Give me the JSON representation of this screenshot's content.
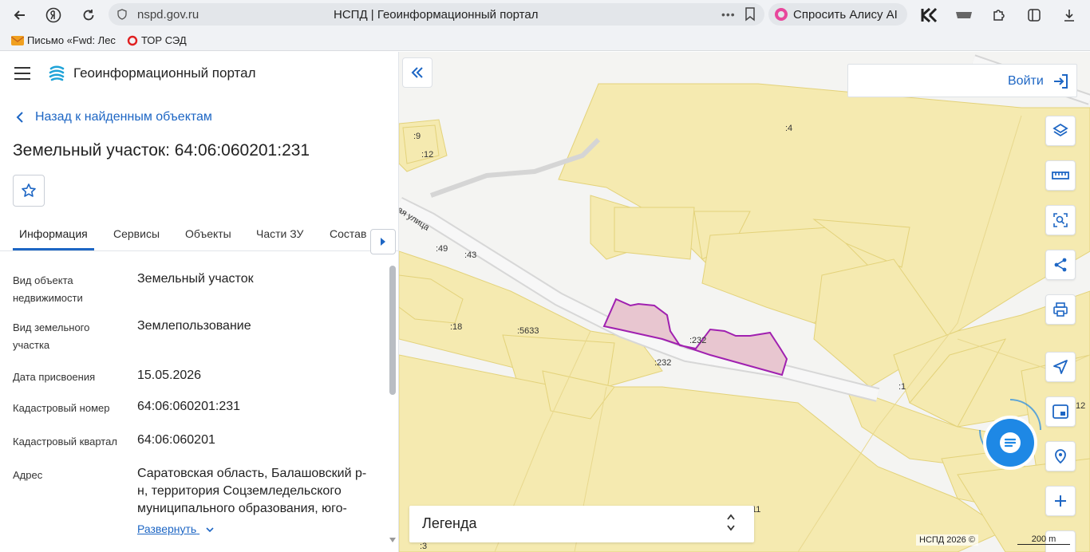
{
  "browser": {
    "url_host": "nspd.gov.ru",
    "page_title": "НСПД | Геоинформационный портал",
    "alice_label": "Спросить Алису AI",
    "bookmarks": [
      {
        "label": "Письмо «Fwd: Лес"
      },
      {
        "label": "ТОР СЭД"
      }
    ]
  },
  "panel": {
    "portal_title": "Геоинформационный портал",
    "back_link": "Назад к найденным объектам",
    "object_title": "Земельный участок: 64:06:060201:231",
    "tabs": [
      "Информация",
      "Сервисы",
      "Объекты",
      "Части ЗУ",
      "Состав"
    ],
    "fields": [
      {
        "label": "Вид объекта недвижимости",
        "value": "Земельный участок"
      },
      {
        "label": "Вид земельного участка",
        "value": "Землепользование"
      },
      {
        "label": "Дата присвоения",
        "value": "15.05.2026"
      },
      {
        "label": "Кадастровый номер",
        "value": "64:06:060201:231"
      },
      {
        "label": "Кадастровый квартал",
        "value": "64:06:060201"
      },
      {
        "label": "Адрес",
        "value": "Саратовская область, Балашовский р-н, территория Соцземледельского муниципального образования, юго-"
      }
    ],
    "expand_link": "Развернуть"
  },
  "map": {
    "login_label": "Войти",
    "legend_title": "Легенда",
    "attribution": "НСПД 2026 ©",
    "scale_label": "200 m",
    "street_label": "ая улица",
    "labels": [
      ":9",
      ":12",
      ":4",
      ":49",
      ":43",
      ":18",
      ":5633",
      ":232",
      ":232",
      ":1",
      "12",
      "11",
      ":3"
    ]
  },
  "colors": {
    "accent": "#1d66c4",
    "parcel_fill": "#f5eab0",
    "parcel_stroke": "#e3d27a",
    "selected_fill": "#e8c6d0",
    "selected_stroke": "#a020b0"
  }
}
